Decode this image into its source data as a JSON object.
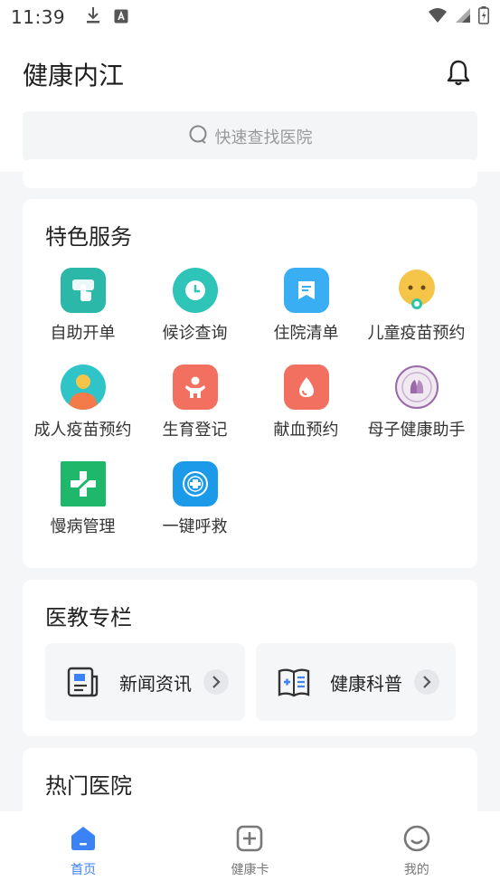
{
  "status_bar": {
    "time": "11:39"
  },
  "header": {
    "title": "健康内江",
    "search_placeholder": "快速查找医院"
  },
  "services": {
    "title": "特色服务",
    "items": [
      {
        "label": "自助开单",
        "icon": "self-order-icon",
        "color": "#2bb8a8"
      },
      {
        "label": "候诊查询",
        "icon": "clock-icon",
        "color": "#2ec4b8"
      },
      {
        "label": "住院清单",
        "icon": "bookmark-doc-icon",
        "color": "#39aef2"
      },
      {
        "label": "儿童疫苗预约",
        "icon": "baby-icon",
        "color": "#f5c54a"
      },
      {
        "label": "成人疫苗预约",
        "icon": "adult-icon",
        "color": "#2ec4c8"
      },
      {
        "label": "生育登记",
        "icon": "child-icon",
        "color": "#f27060"
      },
      {
        "label": "献血预约",
        "icon": "blood-drop-icon",
        "color": "#f27060"
      },
      {
        "label": "母子健康助手",
        "icon": "mother-child-logo-icon",
        "color": "#9a6aa8"
      },
      {
        "label": "慢病管理",
        "icon": "medical-cross-icon",
        "color": "#1fb86a"
      },
      {
        "label": "一键呼救",
        "icon": "emergency-icon",
        "color": "#1a9ae8"
      }
    ]
  },
  "education": {
    "title": "医教专栏",
    "items": [
      {
        "label": "新闻资讯",
        "icon": "newspaper-icon"
      },
      {
        "label": "健康科普",
        "icon": "book-icon"
      }
    ]
  },
  "hot_hospitals": {
    "title": "热门医院"
  },
  "tabbar": {
    "items": [
      {
        "label": "首页",
        "icon": "home-icon",
        "active": true
      },
      {
        "label": "健康卡",
        "icon": "health-card-icon",
        "active": false
      },
      {
        "label": "我的",
        "icon": "profile-icon",
        "active": false
      }
    ]
  },
  "colors": {
    "accent": "#3b82f6",
    "background": "#f5f6f8"
  }
}
